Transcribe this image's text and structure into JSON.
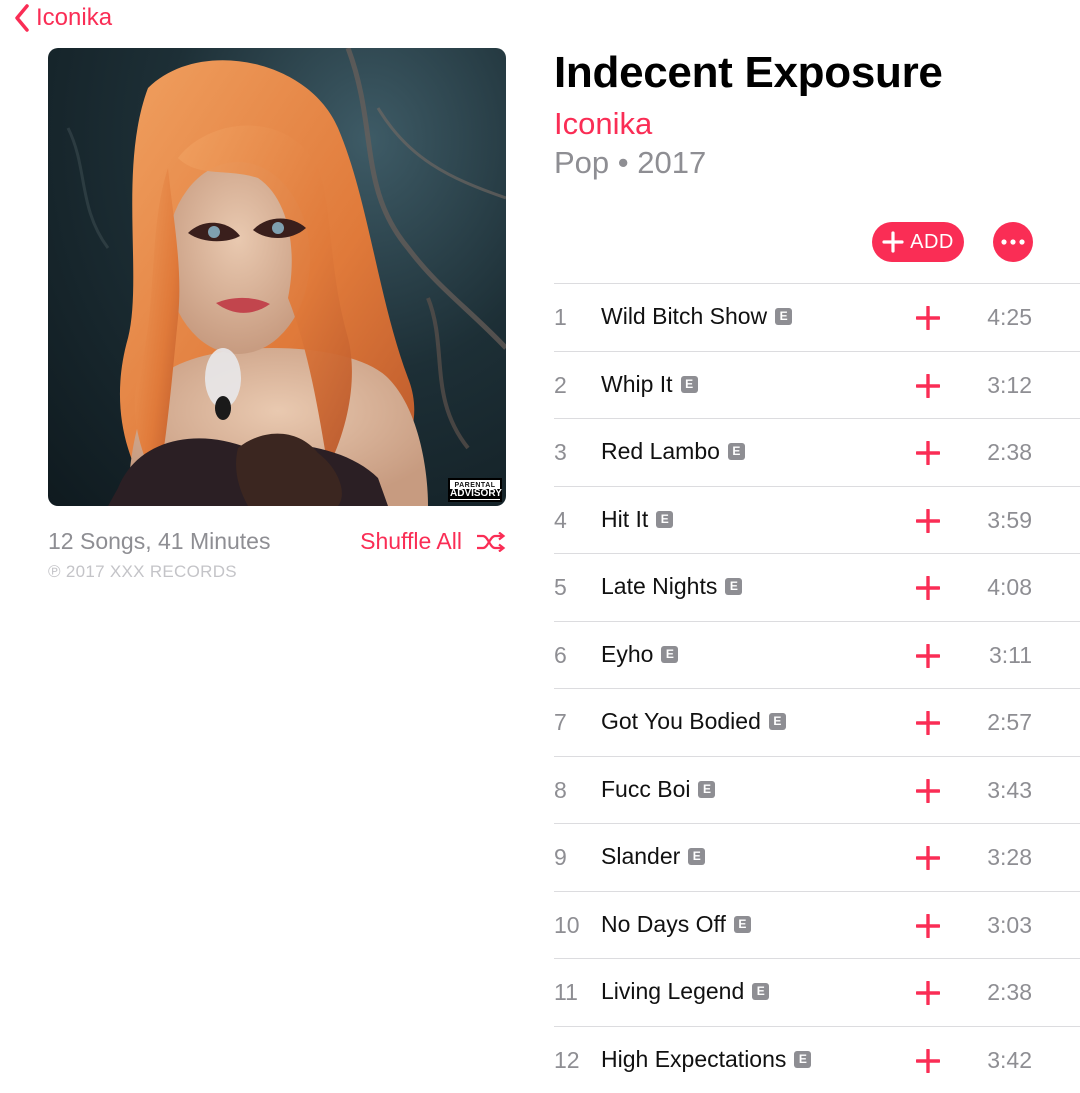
{
  "nav": {
    "back_label": "Iconika"
  },
  "artwork": {
    "advisory_top": "PARENTAL",
    "advisory_bottom": "ADVISORY"
  },
  "album": {
    "title": "Indecent Exposure",
    "artist": "Iconika",
    "genre_year": "Pop • 2017",
    "summary": "12 Songs, 41 Minutes",
    "copyright": "℗ 2017 XXX RECORDS",
    "shuffle_label": "Shuffle All"
  },
  "actions": {
    "add_label": "ADD"
  },
  "colors": {
    "accent": "#fa2d55",
    "secondary_text": "#8e8e93",
    "divider": "#dcdcdf"
  },
  "tracks": [
    {
      "number": "1",
      "title": "Wild Bitch Show",
      "explicit": "E",
      "duration": "4:25"
    },
    {
      "number": "2",
      "title": "Whip It",
      "explicit": "E",
      "duration": "3:12"
    },
    {
      "number": "3",
      "title": "Red Lambo",
      "explicit": "E",
      "duration": "2:38"
    },
    {
      "number": "4",
      "title": "Hit It",
      "explicit": "E",
      "duration": "3:59"
    },
    {
      "number": "5",
      "title": "Late Nights",
      "explicit": "E",
      "duration": "4:08"
    },
    {
      "number": "6",
      "title": "Eyho",
      "explicit": "E",
      "duration": "3:11"
    },
    {
      "number": "7",
      "title": "Got You Bodied",
      "explicit": "E",
      "duration": "2:57"
    },
    {
      "number": "8",
      "title": "Fucc Boi",
      "explicit": "E",
      "duration": "3:43"
    },
    {
      "number": "9",
      "title": "Slander",
      "explicit": "E",
      "duration": "3:28"
    },
    {
      "number": "10",
      "title": "No Days Off",
      "explicit": "E",
      "duration": "3:03"
    },
    {
      "number": "11",
      "title": "Living Legend",
      "explicit": "E",
      "duration": "2:38"
    },
    {
      "number": "12",
      "title": "High Expectations",
      "explicit": "E",
      "duration": "3:42"
    }
  ]
}
